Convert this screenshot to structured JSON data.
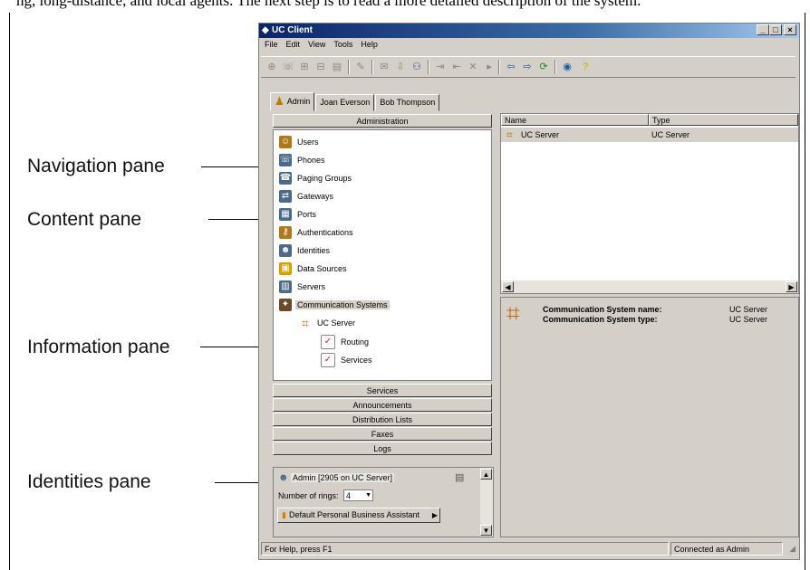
{
  "top_text": "ng, long-distance, and local agents. The next step is to read a more detailed description of the system.",
  "callouts": {
    "navigation": "Navigation pane",
    "content": "Content pane",
    "information": "Information pane",
    "identities": "Identities pane"
  },
  "window": {
    "title": "UC Client",
    "controls": [
      "_",
      "□",
      "×"
    ]
  },
  "menu": [
    "File",
    "Edit",
    "View",
    "Tools",
    "Help"
  ],
  "tabs": [
    {
      "label": "Admin",
      "icon": "person-icon"
    },
    {
      "label": "Joan Everson"
    },
    {
      "label": "Bob Thompson"
    }
  ],
  "nav": {
    "header": "Administration",
    "items": [
      {
        "label": "Users",
        "icon": "users-icon",
        "color": "#b07818"
      },
      {
        "label": "Phones",
        "icon": "phone-icon",
        "color": "#4a6a8a"
      },
      {
        "label": "Paging Groups",
        "icon": "paging-icon",
        "color": "#4a6a8a"
      },
      {
        "label": "Gateways",
        "icon": "gateway-icon",
        "color": "#4a6a8a"
      },
      {
        "label": "Ports",
        "icon": "ports-icon",
        "color": "#4a6a8a"
      },
      {
        "label": "Authentications",
        "icon": "auth-icon",
        "color": "#b07818"
      },
      {
        "label": "Identities",
        "icon": "identities-icon",
        "color": "#4a6a8a"
      },
      {
        "label": "Data Sources",
        "icon": "datasource-icon",
        "color": "#d8a000"
      },
      {
        "label": "Servers",
        "icon": "servers-icon",
        "color": "#4a6a8a"
      },
      {
        "label": "Communication Systems",
        "icon": "comm-systems-icon",
        "color": "#6a4a2a"
      }
    ],
    "server": "UC Server",
    "server_children": [
      "Routing",
      "Services"
    ],
    "bars": [
      "Services",
      "Announcements",
      "Distribution Lists",
      "Faxes",
      "Logs"
    ]
  },
  "content": {
    "columns": [
      "Name",
      "Type"
    ],
    "rows": [
      {
        "name": "UC Server",
        "type": "UC Server"
      }
    ]
  },
  "info": {
    "name_label": "Communication System name:",
    "name_value": "UC Server",
    "type_label": "Communication System type:",
    "type_value": "UC Server"
  },
  "identities": {
    "account": "Admin [2905 on UC Server]",
    "rings_label": "Number of rings:",
    "rings_value": "4",
    "assistant": "Default Personal Business Assistant"
  },
  "status": {
    "help": "For Help, press F1",
    "connection": "Connected as Admin"
  }
}
